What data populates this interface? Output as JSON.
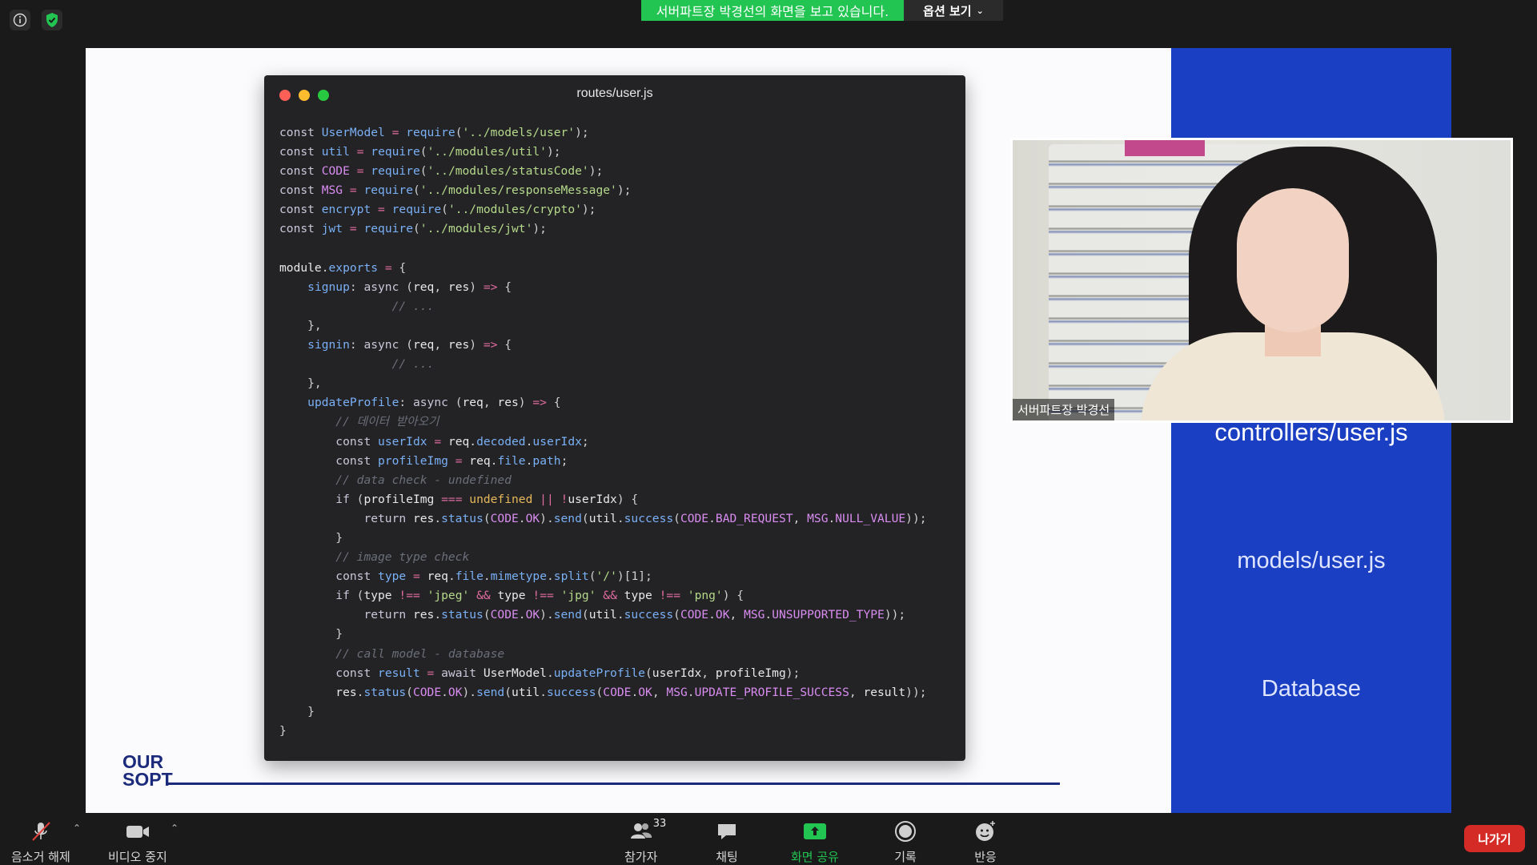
{
  "meeting": {
    "share_banner": "서버파트장 박경선의 화면을 보고 있습니다.",
    "options_label": "옵션 보기",
    "top_icons": [
      "info-icon",
      "shield-icon"
    ],
    "accent_green": "#23c552"
  },
  "slide": {
    "window_title": "routes/user.js",
    "code_lines": [
      "const UserModel = require('../models/user');",
      "const util = require('../modules/util');",
      "const CODE = require('../modules/statusCode');",
      "const MSG = require('../modules/responseMessage');",
      "const encrypt = require('../modules/crypto');",
      "const jwt = require('../modules/jwt');",
      "",
      "module.exports = {",
      "    signup: async (req, res) => {",
      "                // ...",
      "    },",
      "    signin: async (req, res) => {",
      "                // ...",
      "    },",
      "    updateProfile: async (req, res) => {",
      "        // 데이터 받아오기",
      "        const userIdx = req.decoded.userIdx;",
      "        const profileImg = req.file.path;",
      "        // data check - undefined",
      "        if (profileImg === undefined || !userIdx) {",
      "            return res.status(CODE.OK).send(util.success(CODE.BAD_REQUEST, MSG.NULL_VALUE));",
      "        }",
      "        // image type check",
      "        const type = req.file.mimetype.split('/')[1];",
      "        if (type !== 'jpeg' && type !== 'jpg' && type !== 'png') {",
      "            return res.status(CODE.OK).send(util.success(CODE.OK, MSG.UNSUPPORTED_TYPE));",
      "        }",
      "        // call model - database",
      "        const result = await UserModel.updateProfile(userIdx, profileImg);",
      "        res.status(CODE.OK).send(util.success(CODE.OK, MSG.UPDATE_PROFILE_SUCCESS, result));",
      "    }",
      "}"
    ],
    "side_labels": {
      "controllers": "controllers/user.js",
      "models": "models/user.js",
      "database": "Database"
    },
    "logo_line1": "OUR",
    "logo_line2": "SOPT",
    "panel_color": "#1a3fc2"
  },
  "video": {
    "name_tag": "서버파트장 박경선"
  },
  "toolbar": {
    "mute_label": "음소거 해제",
    "video_label": "비디오 중지",
    "participants_label": "참가자",
    "participants_count": "33",
    "chat_label": "채팅",
    "share_label": "화면 공유",
    "record_label": "기록",
    "reactions_label": "반응",
    "leave_label": "나가기"
  }
}
